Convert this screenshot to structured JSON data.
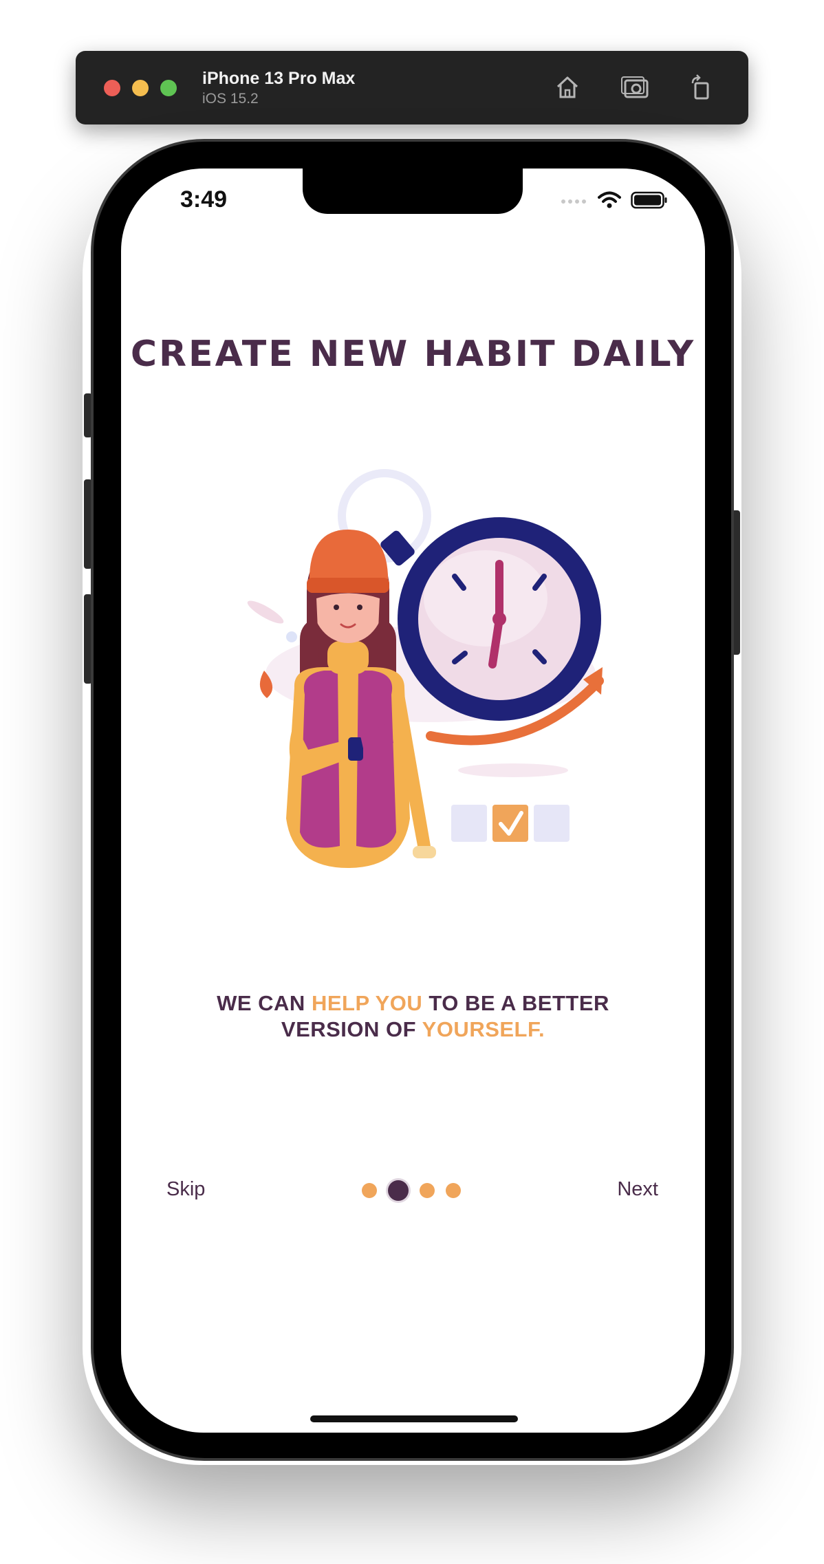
{
  "simulator": {
    "device_name": "iPhone 13 Pro Max",
    "os_version": "iOS 15.2",
    "toolbar_icons": [
      "home-icon",
      "screenshot-icon",
      "rotate-icon"
    ]
  },
  "status_bar": {
    "time": "3:49",
    "icons": [
      "signal-icon",
      "wifi-icon",
      "battery-icon"
    ]
  },
  "onboarding": {
    "headline": "CREATE NEW HABIT DAILY",
    "tagline": {
      "line1_a": "WE CAN ",
      "line1_accent": "HELP YOU",
      "line1_b": " TO BE A BETTER",
      "line2_a": "VERSION OF ",
      "line2_accent": "YOURSELF."
    },
    "skip_label": "Skip",
    "next_label": "Next",
    "page_indicator": {
      "total": 4,
      "current": 2
    }
  },
  "colors": {
    "primary": "#4a2c4a",
    "accent": "#f0a55a",
    "clock_blue": "#1f2278",
    "arrow_orange": "#e8703a"
  }
}
